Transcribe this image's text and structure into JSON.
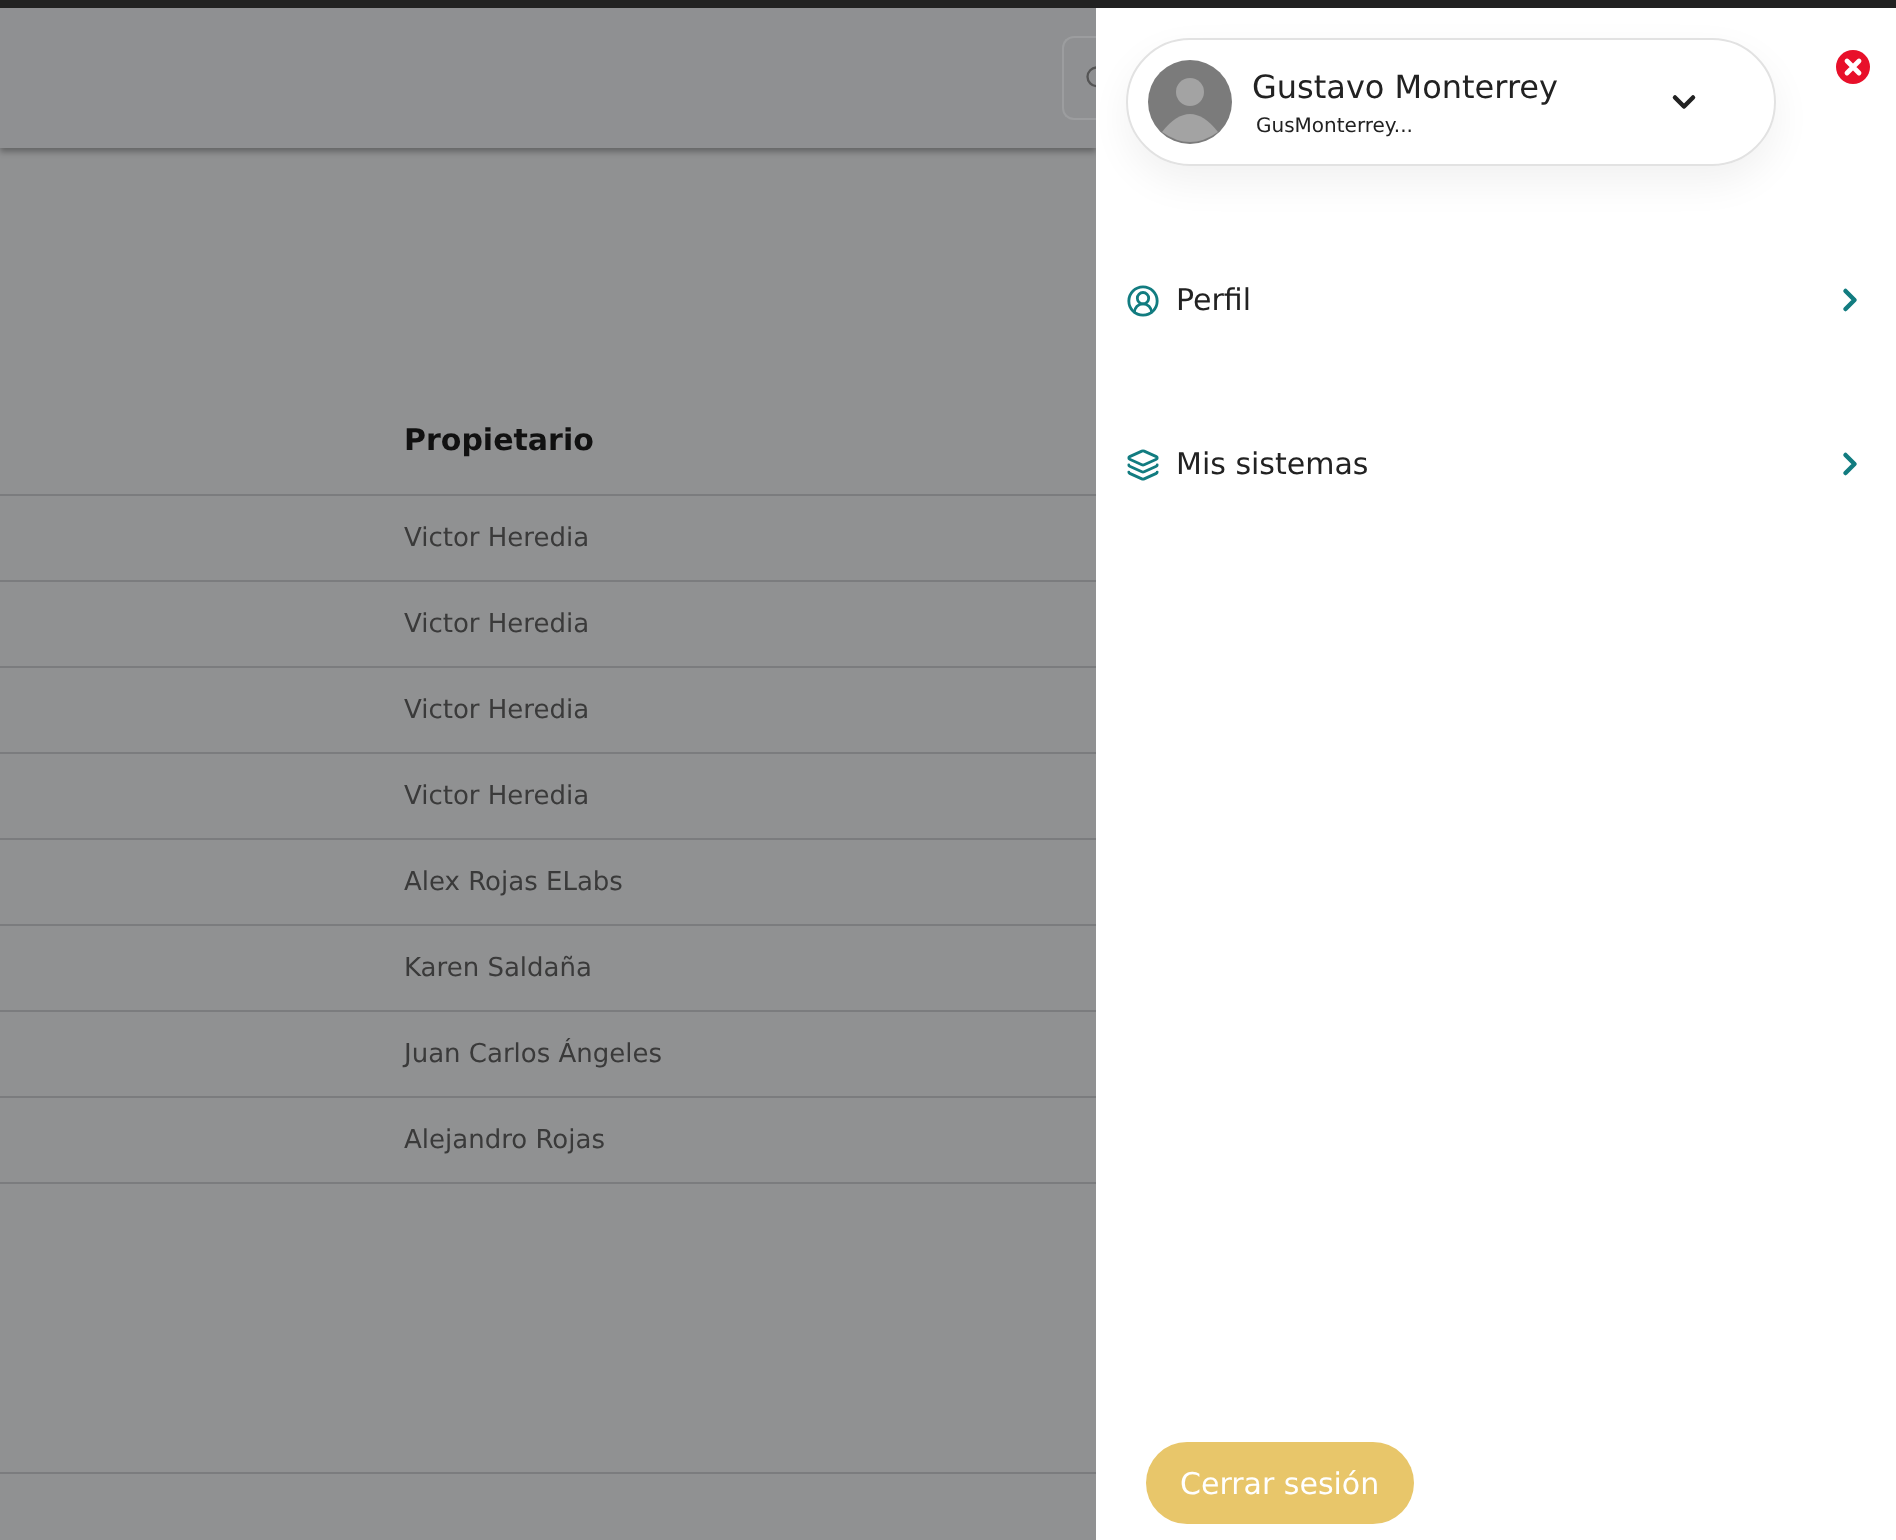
{
  "table": {
    "columns": [
      "Propietario"
    ],
    "rows": [
      {
        "owner": "Victor Heredia"
      },
      {
        "owner": "Victor Heredia"
      },
      {
        "owner": "Victor Heredia"
      },
      {
        "owner": "Victor Heredia"
      },
      {
        "owner": "Alex Rojas ELabs"
      },
      {
        "owner": "Karen Saldaña"
      },
      {
        "owner": "Juan Carlos Ángeles"
      },
      {
        "owner": "Alejandro Rojas"
      }
    ]
  },
  "user_menu": {
    "name": "Gustavo Monterrey",
    "username": "GusMonterrey...",
    "expanded": false
  },
  "menu_items": [
    {
      "kind": "profile",
      "label": "Perfil"
    },
    {
      "kind": "systems",
      "label": "Mis sistemas"
    }
  ],
  "logout_button": "Cerrar sesión"
}
